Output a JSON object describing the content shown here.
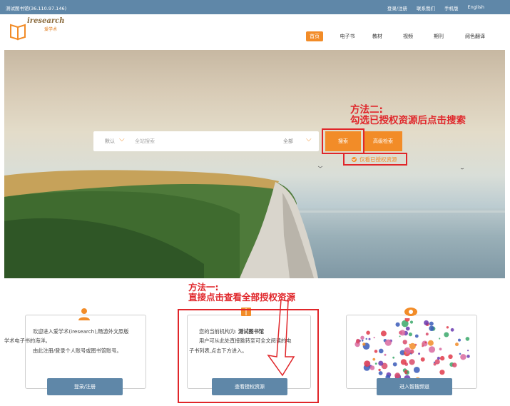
{
  "topbar": {
    "library": "测试图书馆(36.110.97.146)",
    "links": [
      "登录/注册",
      "联系我们",
      "手机版",
      "English"
    ]
  },
  "logo": {
    "text_en": "iresearch",
    "text_cn": "爱学术"
  },
  "nav": {
    "items": [
      {
        "label": "首页",
        "active": true
      },
      {
        "label": "电子书",
        "active": false
      },
      {
        "label": "教材",
        "active": false
      },
      {
        "label": "视频",
        "active": false
      },
      {
        "label": "期刊",
        "active": false
      },
      {
        "label": "阅色翻译",
        "active": false
      }
    ]
  },
  "search": {
    "scope": "默认",
    "placeholder": "全站搜索",
    "type": "全部",
    "search_button": "搜索",
    "advanced_button": "高级检索",
    "authorized_only": "仅看已授权资源",
    "authorized_checked": true
  },
  "annotations": {
    "method2_title": "方法二:",
    "method2_text": "勾选已授权资源后点击搜索",
    "method1_title": "方法一:",
    "method1_text": "直接点击查看全部授权资源"
  },
  "cards": {
    "login": {
      "line1": "欢迎进入爱学术(iresearch),畅游外文原版",
      "line2": "学术电子书的海洋。",
      "line3": "由此注册/登录个人账号或图书馆账号。",
      "button": "登录/注册"
    },
    "resources": {
      "org_label": "您的当前机构为:",
      "org_name": "测试图书馆",
      "line2": "用户可从此处直接跳转至可全文阅读的电",
      "line3": "子书列表,点击下方进入。",
      "button": "查看授权资源"
    },
    "smart": {
      "button": "进入智搜频道"
    }
  },
  "colors": {
    "accent": "#f28c28",
    "topbar": "#5f87a8",
    "annotation": "#e0262a"
  }
}
